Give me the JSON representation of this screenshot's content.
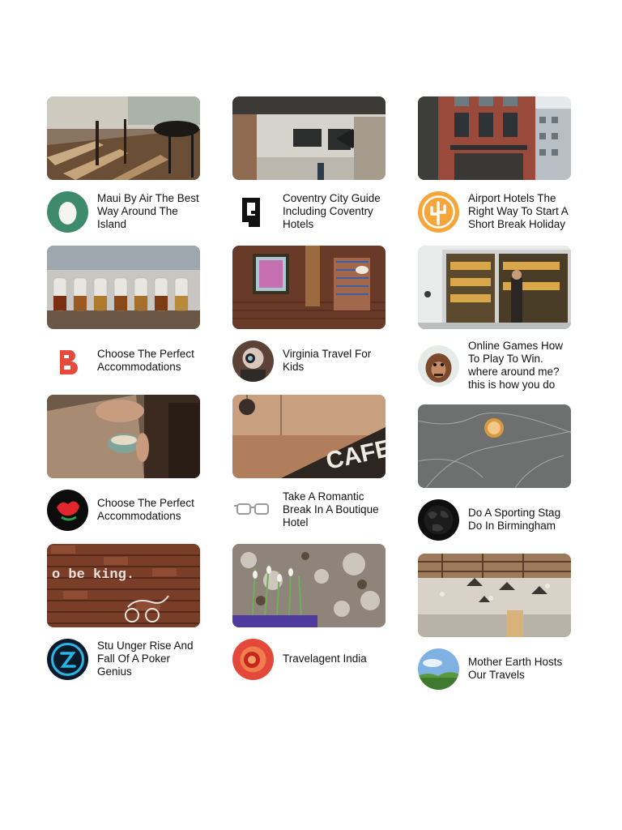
{
  "columns": [
    {
      "cards": [
        {
          "title": "Maui By Air The Best Way Around The Island",
          "image": "cafe-interior-photo",
          "avatar": "egg-logo"
        },
        {
          "title": "Choose The Perfect Accommodations",
          "image": "coffee-carafes-photo",
          "avatar": "red-b-logo"
        },
        {
          "title": "Choose The Perfect Accommodations",
          "image": "latte-pour-photo",
          "avatar": "red-flower-logo"
        },
        {
          "title": "Stu Unger Rise And Fall Of A Poker Genius",
          "image": "brick-wall-mural-photo",
          "avatar": "blue-z-logo"
        }
      ]
    },
    {
      "cards": [
        {
          "title": "Coventry City Guide Including Coventry Hotels",
          "image": "coffee-bar-photo",
          "avatar": "black-g-logo"
        },
        {
          "title": "Virginia Travel For Kids",
          "image": "brick-wall-art-photo",
          "avatar": "photographer-avatar"
        },
        {
          "title": "Take A Romantic Break In A Boutique Hotel",
          "image": "cafe-sign-photo",
          "avatar": "glasses-logo"
        },
        {
          "title": "Travelagent India",
          "image": "flowers-on-stone-photo",
          "avatar": "red-spiral-logo"
        }
      ]
    },
    {
      "cards": [
        {
          "title": "Airport Hotels The Right Way To Start A Short Break Holiday",
          "image": "brick-building-photo",
          "avatar": "orange-cactus-logo"
        },
        {
          "title": "Online Games How To Play To Win. where around me? this is how you do",
          "image": "shop-window-photo",
          "avatar": "orangutan-avatar"
        },
        {
          "title": "Do A Sporting Stag Do In Birmingham",
          "image": "marble-coffee-photo",
          "avatar": "black-world-logo"
        },
        {
          "title": "Mother Earth Hosts Our Travels",
          "image": "industrial-interior-photo",
          "avatar": "sky-landscape-avatar"
        }
      ]
    }
  ]
}
